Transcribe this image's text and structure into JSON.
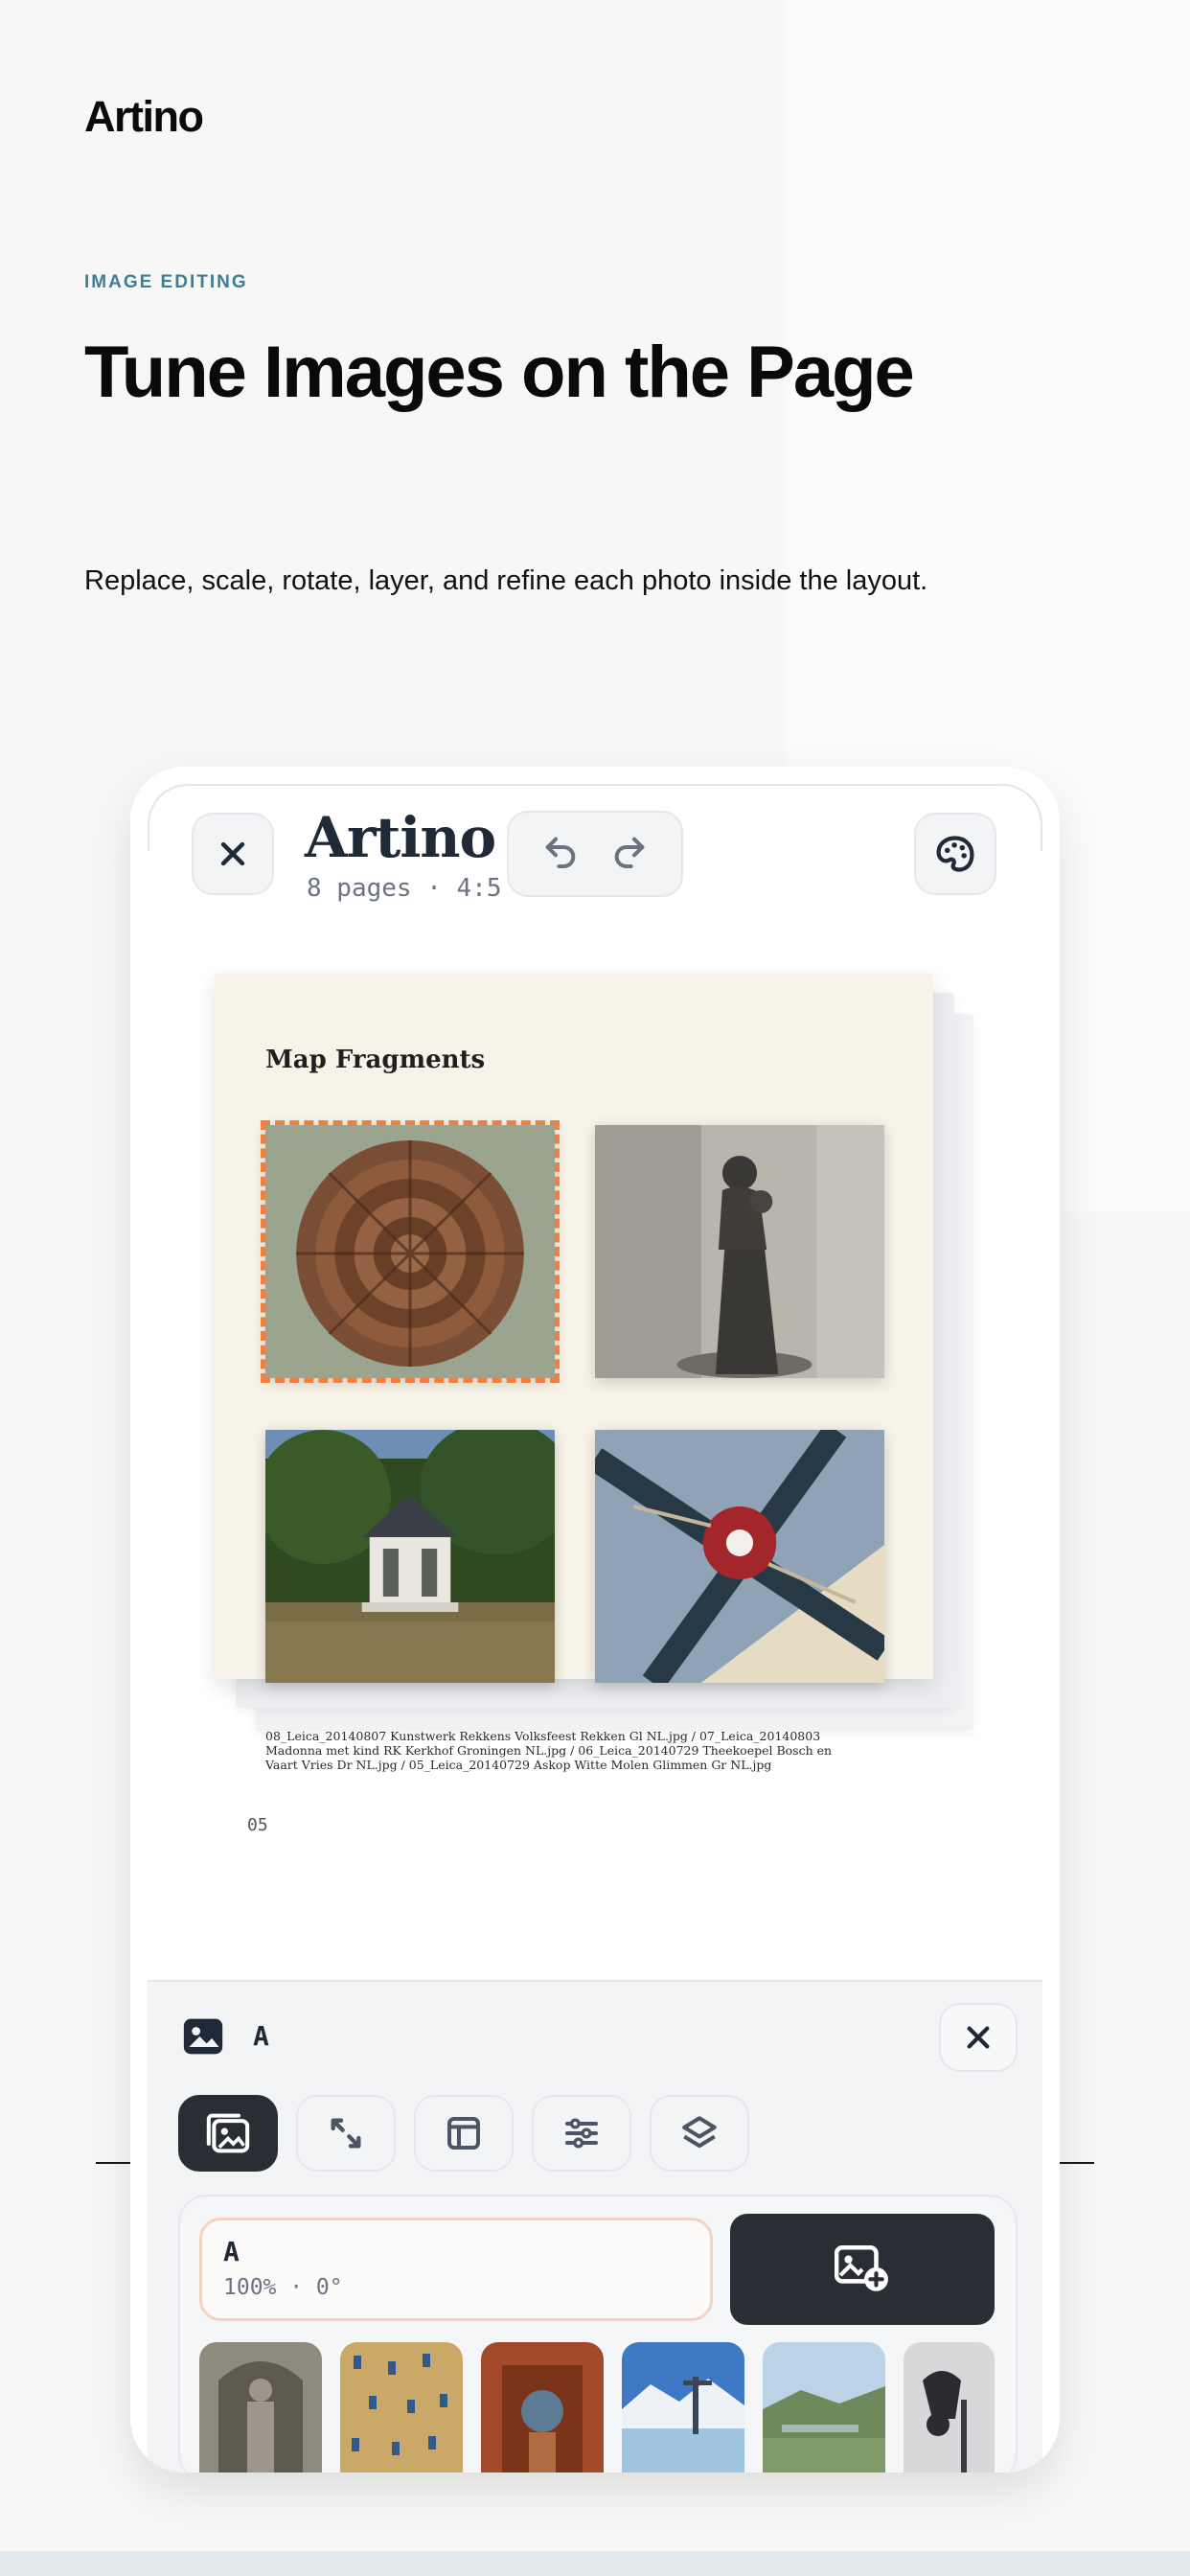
{
  "site": {
    "brand": "Artino",
    "eyebrow": "IMAGE EDITING",
    "headline": "Tune Images on the Page",
    "subline": "Replace, scale, rotate, layer, and refine each photo inside the layout."
  },
  "app": {
    "title": "Artino",
    "meta": "8 pages · 4:5",
    "close_icon": "close-icon",
    "undo_icon": "undo-icon",
    "redo_icon": "redo-icon",
    "theme_icon": "palette-icon"
  },
  "page": {
    "title": "Map Fragments",
    "caption": "08_Leica_20140807 Kunstwerk Rekkens Volksfeest Rekken Gl NL.jpg / 07_Leica_20140803 Madonna met kind RK Kerkhof Groningen NL.jpg / 06_Leica_20140729 Theekoepel Bosch en Vaart Vries Dr NL.jpg / 05_Leica_20140729 Askop Witte Molen Glimmen Gr NL.jpg",
    "number": "05",
    "photos": [
      {
        "subject": "pinecone",
        "selected": true
      },
      {
        "subject": "madonna-statue",
        "selected": false
      },
      {
        "subject": "gazebo",
        "selected": false
      },
      {
        "subject": "windmill",
        "selected": false
      }
    ]
  },
  "panel": {
    "label": "A",
    "image_icon": "image-icon",
    "close_icon": "close-icon",
    "tools": [
      {
        "name": "replace",
        "icon": "replace-image-icon",
        "active": true
      },
      {
        "name": "scale",
        "icon": "resize-icon",
        "active": false
      },
      {
        "name": "crop",
        "icon": "frame-icon",
        "active": false
      },
      {
        "name": "adjust",
        "icon": "sliders-icon",
        "active": false
      },
      {
        "name": "layer",
        "icon": "layers-icon",
        "active": false
      }
    ],
    "field": {
      "name": "A",
      "value": "100% · 0°"
    },
    "add_icon": "add-image-icon",
    "thumbnails": [
      "statue",
      "textile",
      "sphere-sculpture",
      "harbor",
      "landscape",
      "bird"
    ]
  },
  "colors": {
    "accent": "#3d7d96",
    "selection": "#f08040",
    "dark": "#2a2d33",
    "paper": "#f7f3e8"
  }
}
